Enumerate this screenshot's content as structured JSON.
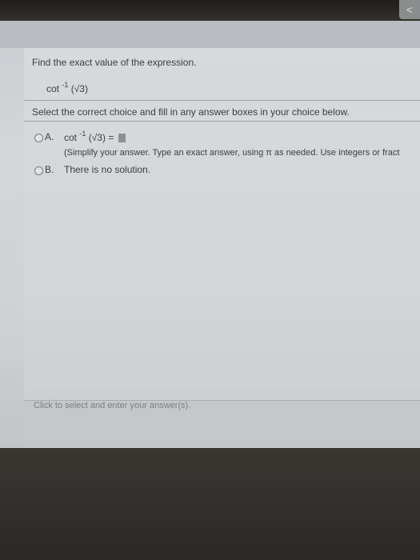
{
  "window": {
    "corner_icon": "back-arrow-icon",
    "corner_glyph": "<"
  },
  "question": {
    "prompt": "Find the exact value of the expression.",
    "expr_func": "cot",
    "expr_sup": "-1",
    "expr_arg": "(√3)"
  },
  "instructions": "Select the correct choice and fill in any answer boxes in your choice below.",
  "choices": [
    {
      "letter": "A.",
      "func": "cot",
      "sup": "-1",
      "arg": "(√3)",
      "equals": "=",
      "note": "(Simplify your answer. Type an exact answer, using π as needed. Use integers or fract"
    },
    {
      "letter": "B.",
      "text": "There is no solution."
    }
  ],
  "footer": {
    "hint": "Click to select and enter your answer(s)."
  }
}
